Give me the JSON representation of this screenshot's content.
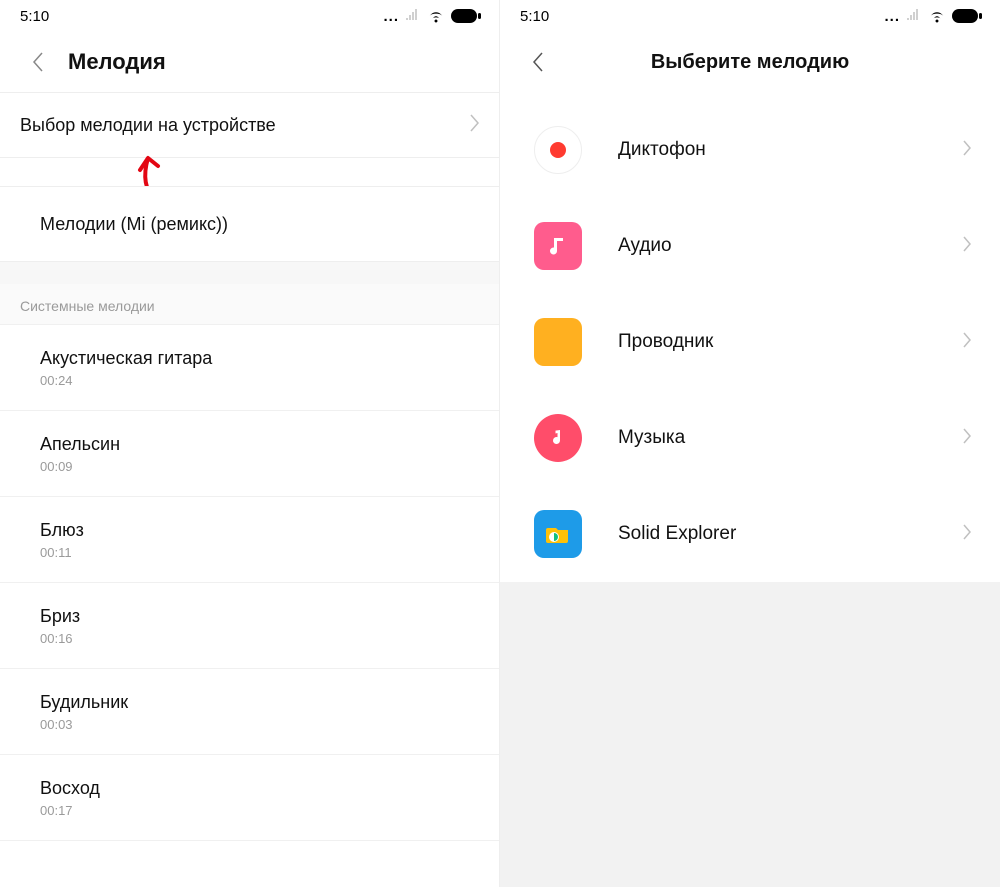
{
  "status": {
    "time": "5:10"
  },
  "left": {
    "title": "Мелодия",
    "device_row": "Выбор мелодии на устройстве",
    "remix_row": "Мелодии (Mi (ремикс))",
    "section": "Системные мелодии",
    "songs": [
      {
        "title": "Акустическая гитара",
        "dur": "00:24"
      },
      {
        "title": "Апельсин",
        "dur": "00:09"
      },
      {
        "title": "Блюз",
        "dur": "00:11"
      },
      {
        "title": "Бриз",
        "dur": "00:16"
      },
      {
        "title": "Будильник",
        "dur": "00:03"
      },
      {
        "title": "Восход",
        "dur": "00:17"
      }
    ]
  },
  "right": {
    "title": "Выберите мелодию",
    "sources": [
      {
        "name": "Диктофон"
      },
      {
        "name": "Аудио"
      },
      {
        "name": "Проводник"
      },
      {
        "name": "Музыка"
      },
      {
        "name": "Solid Explorer"
      }
    ]
  }
}
